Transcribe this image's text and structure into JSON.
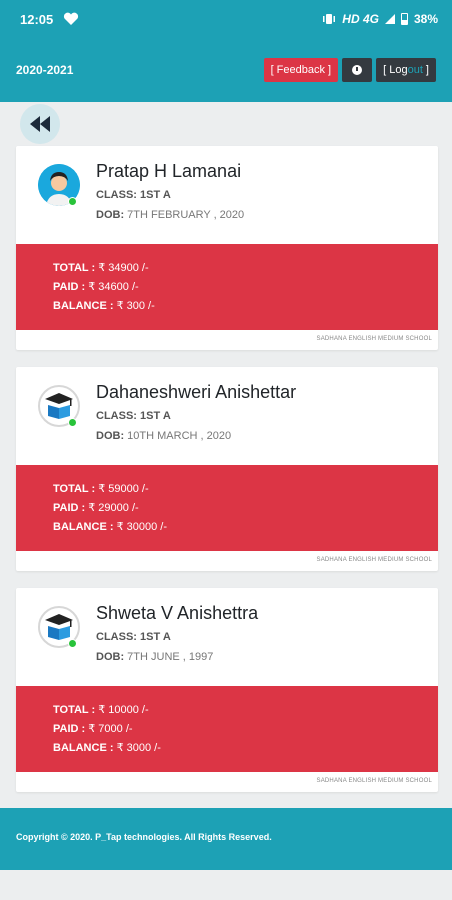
{
  "status_bar": {
    "time": "12:05",
    "network": "HD 4G",
    "battery": "38%"
  },
  "header": {
    "year": "2020-2021",
    "feedback_label": "[ Feedback ]",
    "logout_prefix": "[ Log",
    "logout_accent": "out",
    "logout_suffix": " ]"
  },
  "students": [
    {
      "name": "Pratap H Lamanai",
      "class_label": "CLASS:",
      "class_value": "1ST A",
      "dob_label": "DOB:",
      "dob_value": "7TH FEBRUARY , 2020",
      "total_label": "TOTAL :",
      "total_value": "₹ 34900 /-",
      "paid_label": "PAID :",
      "paid_value": "₹ 34600 /-",
      "balance_label": "BALANCE :",
      "balance_value": "₹ 300 /-",
      "school": "SADHANA ENGLISH MEDIUM SCHOOL",
      "avatar": "boy-avatar-icon"
    },
    {
      "name": "Dahaneshweri Anishettar",
      "class_label": "CLASS:",
      "class_value": "1ST A",
      "dob_label": "DOB:",
      "dob_value": "10TH MARCH , 2020",
      "total_label": "TOTAL :",
      "total_value": "₹ 59000 /-",
      "paid_label": "PAID :",
      "paid_value": "₹ 29000 /-",
      "balance_label": "BALANCE :",
      "balance_value": "₹ 30000 /-",
      "school": "SADHANA ENGLISH MEDIUM SCHOOL",
      "avatar": "graduation-book-icon"
    },
    {
      "name": "Shweta V Anishettra",
      "class_label": "CLASS:",
      "class_value": "1ST A",
      "dob_label": "DOB:",
      "dob_value": "7TH JUNE , 1997",
      "total_label": "TOTAL :",
      "total_value": "₹ 10000 /-",
      "paid_label": "PAID :",
      "paid_value": "₹ 7000 /-",
      "balance_label": "BALANCE :",
      "balance_value": "₹ 3000 /-",
      "school": "SADHANA ENGLISH MEDIUM SCHOOL",
      "avatar": "graduation-book-icon"
    }
  ],
  "footer": {
    "copyright": "Copyright © 2020. P_Tap technologies. All Rights Reserved."
  },
  "colors": {
    "primary": "#1da1b5",
    "danger": "#dc3545",
    "dark": "#343a40",
    "online": "#28c33a"
  }
}
